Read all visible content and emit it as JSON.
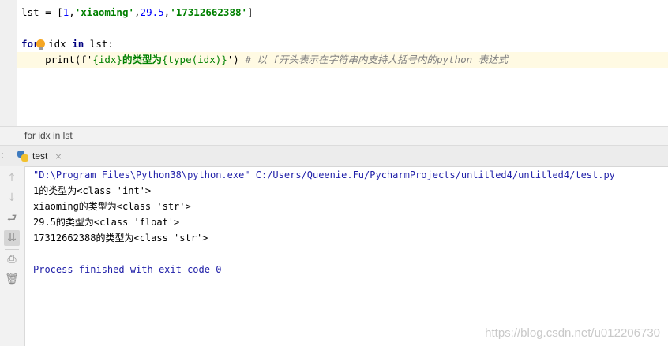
{
  "editor": {
    "line1": {
      "var": "lst",
      "assign": " = [",
      "v1": "1",
      "c1": ",",
      "v2": "'xiaoming'",
      "c2": ",",
      "v3": "29.5",
      "c3": ",",
      "v4": "'17312662388'",
      "close": "]"
    },
    "line3": {
      "kw_for": "for",
      "mid": " idx ",
      "kw_in": "in",
      "tail": " lst:"
    },
    "line4": {
      "indent": "    ",
      "call_start": "print(f'",
      "fexpr1": "{idx}",
      "fstr_text": "的类型为",
      "fexpr2": "{type(idx)}",
      "call_end": "')",
      "comment": " # 以 f开头表示在字符串内支持大括号内的python 表达式"
    }
  },
  "breadcrumb": "for idx in lst",
  "run": {
    "colon": ":",
    "tab_label": "test",
    "close": "×",
    "console": [
      "\"D:\\Program Files\\Python38\\python.exe\" C:/Users/Queenie.Fu/PycharmProjects/untitled4/untitled4/test.py",
      "1的类型为<class 'int'>",
      "xiaoming的类型为<class 'str'>",
      "29.5的类型为<class 'float'>",
      "17312662388的类型为<class 'str'>",
      "",
      "Process finished with exit code 0"
    ]
  },
  "toolbar": {
    "up": "↑",
    "down": "↓",
    "wrap": "⮐",
    "scroll": "⇊",
    "print": "⎙",
    "trash": "🗑"
  },
  "watermark": "https://blog.csdn.net/u012206730"
}
